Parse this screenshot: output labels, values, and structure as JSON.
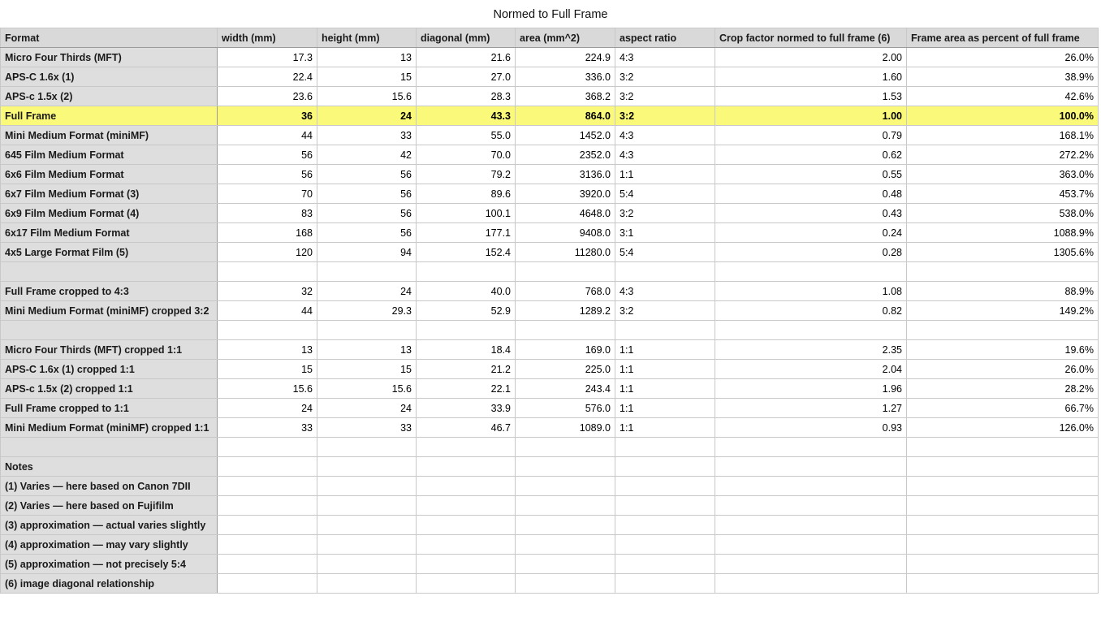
{
  "sheet": {
    "title": "Normed to Full Frame",
    "headers": [
      "Format",
      "width (mm)",
      "height (mm)",
      "diagonal (mm)",
      "area (mm^2)",
      "aspect ratio",
      "Crop factor normed to full frame (6)",
      "Frame area as percent of full frame"
    ],
    "highlight_color": "#fbf97a",
    "rows": [
      {
        "cells": [
          "Micro Four Thirds (MFT)",
          "17.3",
          "13",
          "21.6",
          "224.9",
          "4:3",
          "2.00",
          "26.0%"
        ]
      },
      {
        "cells": [
          "APS-C 1.6x (1)",
          "22.4",
          "15",
          "27.0",
          "336.0",
          "3:2",
          "1.60",
          "38.9%"
        ]
      },
      {
        "cells": [
          "APS-c 1.5x (2)",
          "23.6",
          "15.6",
          "28.3",
          "368.2",
          "3:2",
          "1.53",
          "42.6%"
        ]
      },
      {
        "cells": [
          "Full Frame",
          "36",
          "24",
          "43.3",
          "864.0",
          "3:2",
          "1.00",
          "100.0%"
        ],
        "highlight": true
      },
      {
        "cells": [
          "Mini Medium Format (miniMF)",
          "44",
          "33",
          "55.0",
          "1452.0",
          "4:3",
          "0.79",
          "168.1%"
        ]
      },
      {
        "cells": [
          "645 Film Medium Format",
          "56",
          "42",
          "70.0",
          "2352.0",
          "4:3",
          "0.62",
          "272.2%"
        ]
      },
      {
        "cells": [
          "6x6 Film Medium Format",
          "56",
          "56",
          "79.2",
          "3136.0",
          "1:1",
          "0.55",
          "363.0%"
        ]
      },
      {
        "cells": [
          "6x7 Film Medium Format (3)",
          "70",
          "56",
          "89.6",
          "3920.0",
          "5:4",
          "0.48",
          "453.7%"
        ]
      },
      {
        "cells": [
          "6x9 Film Medium Format (4)",
          "83",
          "56",
          "100.1",
          "4648.0",
          "3:2",
          "0.43",
          "538.0%"
        ]
      },
      {
        "cells": [
          "6x17 Film Medium Format",
          "168",
          "56",
          "177.1",
          "9408.0",
          "3:1",
          "0.24",
          "1088.9%"
        ]
      },
      {
        "cells": [
          "4x5 Large Format Film (5)",
          "120",
          "94",
          "152.4",
          "11280.0",
          "5:4",
          "0.28",
          "1305.6%"
        ]
      },
      {
        "cells": [
          "",
          "",
          "",
          "",
          "",
          "",
          "",
          ""
        ]
      },
      {
        "cells": [
          "Full Frame cropped to 4:3",
          "32",
          "24",
          "40.0",
          "768.0",
          "4:3",
          "1.08",
          "88.9%"
        ]
      },
      {
        "cells": [
          "Mini Medium Format (miniMF) cropped 3:2",
          "44",
          "29.3",
          "52.9",
          "1289.2",
          "3:2",
          "0.82",
          "149.2%"
        ]
      },
      {
        "cells": [
          "",
          "",
          "",
          "",
          "",
          "",
          "",
          ""
        ]
      },
      {
        "cells": [
          "Micro Four Thirds (MFT) cropped 1:1",
          "13",
          "13",
          "18.4",
          "169.0",
          "1:1",
          "2.35",
          "19.6%"
        ]
      },
      {
        "cells": [
          "APS-C 1.6x (1) cropped 1:1",
          "15",
          "15",
          "21.2",
          "225.0",
          "1:1",
          "2.04",
          "26.0%"
        ]
      },
      {
        "cells": [
          "APS-c 1.5x (2) cropped 1:1",
          "15.6",
          "15.6",
          "22.1",
          "243.4",
          "1:1",
          "1.96",
          "28.2%"
        ]
      },
      {
        "cells": [
          "Full Frame cropped to 1:1",
          "24",
          "24",
          "33.9",
          "576.0",
          "1:1",
          "1.27",
          "66.7%"
        ]
      },
      {
        "cells": [
          "Mini Medium Format (miniMF) cropped 1:1",
          "33",
          "33",
          "46.7",
          "1089.0",
          "1:1",
          "0.93",
          "126.0%"
        ]
      },
      {
        "cells": [
          "",
          "",
          "",
          "",
          "",
          "",
          "",
          ""
        ]
      },
      {
        "cells": [
          "Notes",
          "",
          "",
          "",
          "",
          "",
          "",
          ""
        ]
      },
      {
        "cells": [
          "(1) Varies — here based on Canon 7DII",
          "",
          "",
          "",
          "",
          "",
          "",
          ""
        ]
      },
      {
        "cells": [
          "(2) Varies — here based on Fujifilm",
          "",
          "",
          "",
          "",
          "",
          "",
          ""
        ]
      },
      {
        "cells": [
          "(3) approximation — actual varies slightly",
          "",
          "",
          "",
          "",
          "",
          "",
          ""
        ]
      },
      {
        "cells": [
          "(4) approximation — may vary slightly",
          "",
          "",
          "",
          "",
          "",
          "",
          ""
        ]
      },
      {
        "cells": [
          "(5) approximation — not precisely 5:4",
          "",
          "",
          "",
          "",
          "",
          "",
          ""
        ]
      },
      {
        "cells": [
          "(6) image diagonal relationship",
          "",
          "",
          "",
          "",
          "",
          "",
          ""
        ]
      }
    ]
  }
}
